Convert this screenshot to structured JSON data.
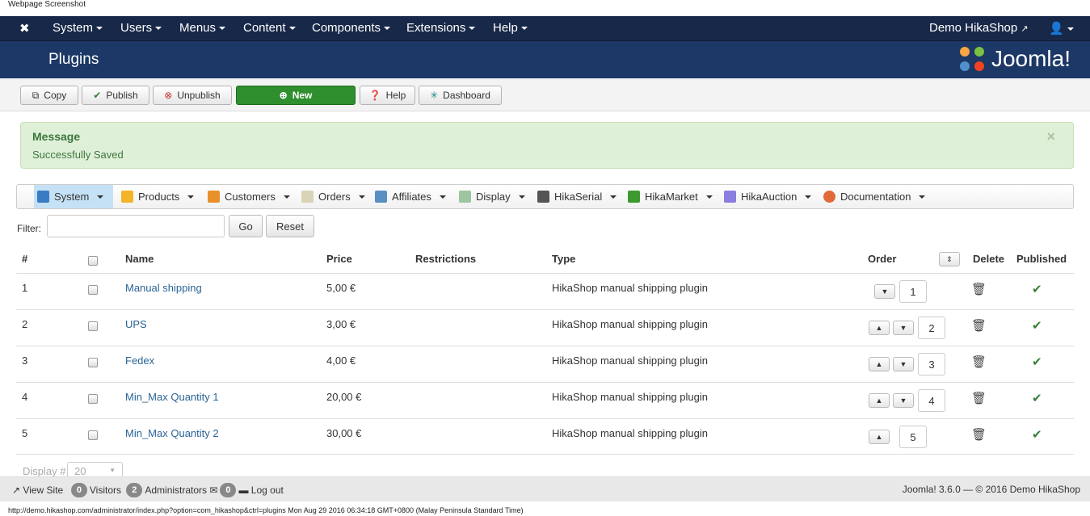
{
  "caption": "Webpage Screenshot",
  "navbar": {
    "items": [
      "System",
      "Users",
      "Menus",
      "Content",
      "Components",
      "Extensions",
      "Help"
    ],
    "site": "Demo HikaShop"
  },
  "header": {
    "title": "Plugins",
    "logo": "Joomla!"
  },
  "toolbar": {
    "copy": "Copy",
    "publish": "Publish",
    "unpublish": "Unpublish",
    "new": "New",
    "help": "Help",
    "dashboard": "Dashboard"
  },
  "message": {
    "title": "Message",
    "text": "Successfully Saved",
    "close": "×"
  },
  "submenu": [
    "System",
    "Products",
    "Customers",
    "Orders",
    "Affiliates",
    "Display",
    "HikaSerial",
    "HikaMarket",
    "HikaAuction",
    "Documentation"
  ],
  "filter": {
    "label": "Filter:",
    "value": "",
    "go": "Go",
    "reset": "Reset"
  },
  "table": {
    "headers": {
      "num": "#",
      "name": "Name",
      "price": "Price",
      "restrictions": "Restrictions",
      "type": "Type",
      "order": "Order",
      "delete": "Delete",
      "published": "Published"
    },
    "rows": [
      {
        "num": "1",
        "name": "Manual shipping",
        "price": "5,00 €",
        "restrictions": "",
        "type": "HikaShop manual shipping plugin",
        "order": "1"
      },
      {
        "num": "2",
        "name": "UPS",
        "price": "3,00 €",
        "restrictions": "",
        "type": "HikaShop manual shipping plugin",
        "order": "2"
      },
      {
        "num": "3",
        "name": "Fedex",
        "price": "4,00 €",
        "restrictions": "",
        "type": "HikaShop manual shipping plugin",
        "order": "3"
      },
      {
        "num": "4",
        "name": "Min_Max Quantity 1",
        "price": "20,00 €",
        "restrictions": "",
        "type": "HikaShop manual shipping plugin",
        "order": "4"
      },
      {
        "num": "5",
        "name": "Min_Max Quantity 2",
        "price": "30,00 €",
        "restrictions": "",
        "type": "HikaShop manual shipping plugin",
        "order": "5"
      }
    ]
  },
  "display": {
    "label": "Display #",
    "value": "20"
  },
  "footer": {
    "view_site": "View Site",
    "visitors_count": "0",
    "visitors": "Visitors",
    "admins_count": "2",
    "admins": "Administrators",
    "messages_count": "0",
    "logout": "Log out",
    "copyright": "Joomla! 3.6.0  —  © 2016 Demo HikaShop"
  },
  "status": "http://demo.hikashop.com/administrator/index.php?option=com_hikashop&ctrl=plugins Mon Aug 29 2016 06:34:18 GMT+0800 (Malay Peninsula Standard Time)"
}
